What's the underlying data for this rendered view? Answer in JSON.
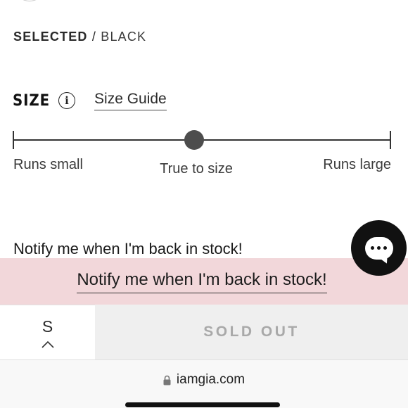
{
  "selected": {
    "key": "SELECTED",
    "separator": "/",
    "value": "BLACK"
  },
  "size": {
    "heading": "SIZE",
    "info_glyph": "i",
    "guide_link": "Size Guide"
  },
  "fit": {
    "label_small": "Runs small",
    "label_true": "True to size",
    "label_large": "Runs large",
    "position_fraction": 0.48
  },
  "notify": {
    "text": "Notify me when I'm back in stock!",
    "banner_link": "Notify me when I'm back in stock!",
    "banner_color": "#f2d7da"
  },
  "buy": {
    "selected_size": "S",
    "sold_out_label": "SOLD OUT"
  },
  "chat": {
    "icon": "chat-bubble-icon"
  },
  "browser": {
    "url": "iamgia.com",
    "icon": "lock-icon"
  }
}
